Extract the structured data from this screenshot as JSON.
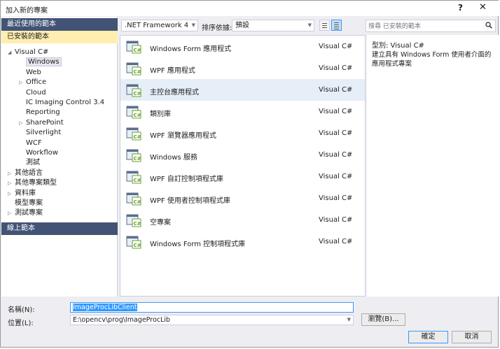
{
  "window": {
    "title": "加入新的專案",
    "help": "?",
    "close": "✕"
  },
  "sidebar": {
    "recent": "最近使用的範本",
    "installed": "已安裝的範本",
    "online": "線上範本",
    "tree": [
      {
        "label": "Visual C#",
        "level": 0,
        "arrow": "◢"
      },
      {
        "label": "Windows",
        "level": 1,
        "arrow": "",
        "selected": true
      },
      {
        "label": "Web",
        "level": 1,
        "arrow": ""
      },
      {
        "label": "Office",
        "level": 1,
        "arrow": "▷"
      },
      {
        "label": "Cloud",
        "level": 1,
        "arrow": ""
      },
      {
        "label": "IC Imaging Control 3.4",
        "level": 1,
        "arrow": ""
      },
      {
        "label": "Reporting",
        "level": 1,
        "arrow": ""
      },
      {
        "label": "SharePoint",
        "level": 1,
        "arrow": "▷"
      },
      {
        "label": "Silverlight",
        "level": 1,
        "arrow": ""
      },
      {
        "label": "WCF",
        "level": 1,
        "arrow": ""
      },
      {
        "label": "Workflow",
        "level": 1,
        "arrow": ""
      },
      {
        "label": "測試",
        "level": 1,
        "arrow": ""
      },
      {
        "label": "其他語言",
        "level": 0,
        "arrow": "▷"
      },
      {
        "label": "其他專案類型",
        "level": 0,
        "arrow": "▷"
      },
      {
        "label": "資料庫",
        "level": 0,
        "arrow": "▷"
      },
      {
        "label": "模型專案",
        "level": 0,
        "arrow": ""
      },
      {
        "label": "測試專案",
        "level": 0,
        "arrow": "▷"
      }
    ]
  },
  "toolbar": {
    "framework": ".NET Framework 4",
    "sort_label": "排序依據:",
    "sort_value": "預設",
    "search_placeholder": "搜尋 已安裝的範本"
  },
  "templates": [
    {
      "name": "Windows Form 應用程式",
      "lang": "Visual C#",
      "icon": "winform-app-icon"
    },
    {
      "name": "WPF 應用程式",
      "lang": "Visual C#",
      "icon": "wpf-app-icon"
    },
    {
      "name": "主控台應用程式",
      "lang": "Visual C#",
      "icon": "console-app-icon",
      "hover": true
    },
    {
      "name": "類別庫",
      "lang": "Visual C#",
      "icon": "class-library-icon"
    },
    {
      "name": "WPF 瀏覽器應用程式",
      "lang": "Visual C#",
      "icon": "wpf-browser-app-icon"
    },
    {
      "name": "Windows 服務",
      "lang": "Visual C#",
      "icon": "windows-service-icon"
    },
    {
      "name": "WPF 自訂控制項程式庫",
      "lang": "Visual C#",
      "icon": "wpf-custom-control-icon"
    },
    {
      "name": "WPF 使用者控制項程式庫",
      "lang": "Visual C#",
      "icon": "wpf-user-control-icon"
    },
    {
      "name": "空專案",
      "lang": "Visual C#",
      "icon": "empty-project-icon"
    },
    {
      "name": "Windows Form 控制項程式庫",
      "lang": "Visual C#",
      "icon": "winform-control-library-icon"
    }
  ],
  "description": {
    "type": "型別:  Visual C#",
    "text": "建立具有 Windows Form 使用者介面的應用程式專案"
  },
  "form": {
    "name_label": "名稱(N):",
    "name_value": "ImageProcLibClient",
    "location_label": "位置(L):",
    "location_value": "E:\\opencv\\prog\\ImageProcLib",
    "browse": "瀏覽(B)...",
    "ok": "確定",
    "cancel": "取消"
  },
  "colors": {
    "accent": "#425375",
    "selected": "#ffeeb0",
    "csharp_green": "#68a12e"
  }
}
